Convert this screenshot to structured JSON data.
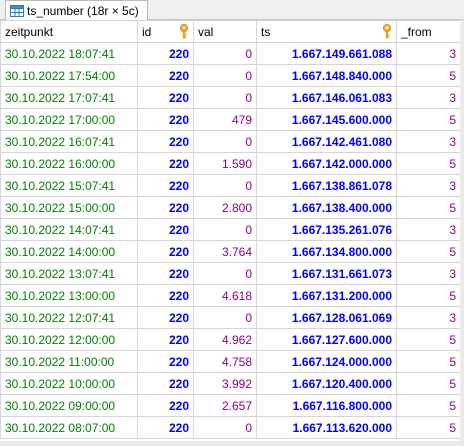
{
  "tab": {
    "icon": "table-icon",
    "label": "ts_number (18r × 5c)"
  },
  "columns": [
    {
      "label": "zeitpunkt",
      "key": false
    },
    {
      "label": "id",
      "key": true
    },
    {
      "label": "val",
      "key": false
    },
    {
      "label": "ts",
      "key": true
    },
    {
      "label": "_from",
      "key": false
    }
  ],
  "rows": [
    [
      "30.10.2022 18:07:41",
      "220",
      "0",
      "1.667.149.661.088",
      "3"
    ],
    [
      "30.10.2022 17:54:00",
      "220",
      "0",
      "1.667.148.840.000",
      "5"
    ],
    [
      "30.10.2022 17:07:41",
      "220",
      "0",
      "1.667.146.061.083",
      "3"
    ],
    [
      "30.10.2022 17:00:00",
      "220",
      "479",
      "1.667.145.600.000",
      "5"
    ],
    [
      "30.10.2022 16:07:41",
      "220",
      "0",
      "1.667.142.461.080",
      "3"
    ],
    [
      "30.10.2022 16:00:00",
      "220",
      "1.590",
      "1.667.142.000.000",
      "5"
    ],
    [
      "30.10.2022 15:07:41",
      "220",
      "0",
      "1.667.138.861.078",
      "3"
    ],
    [
      "30.10.2022 15:00:00",
      "220",
      "2.800",
      "1.667.138.400.000",
      "5"
    ],
    [
      "30.10.2022 14:07:41",
      "220",
      "0",
      "1.667.135.261.076",
      "3"
    ],
    [
      "30.10.2022 14:00:00",
      "220",
      "3.764",
      "1.667.134.800.000",
      "5"
    ],
    [
      "30.10.2022 13:07:41",
      "220",
      "0",
      "1.667.131.661.073",
      "3"
    ],
    [
      "30.10.2022 13:00:00",
      "220",
      "4.618",
      "1.667.131.200.000",
      "5"
    ],
    [
      "30.10.2022 12:07:41",
      "220",
      "0",
      "1.667.128.061.069",
      "3"
    ],
    [
      "30.10.2022 12:00:00",
      "220",
      "4.962",
      "1.667.127.600.000",
      "5"
    ],
    [
      "30.10.2022 11:00:00",
      "220",
      "4.758",
      "1.667.124.000.000",
      "5"
    ],
    [
      "30.10.2022 10:00:00",
      "220",
      "3.992",
      "1.667.120.400.000",
      "5"
    ],
    [
      "30.10.2022 09:00:00",
      "220",
      "2.657",
      "1.667.116.800.000",
      "5"
    ],
    [
      "30.10.2022 08:07:00",
      "220",
      "0",
      "1.667.113.620.000",
      "5"
    ]
  ]
}
